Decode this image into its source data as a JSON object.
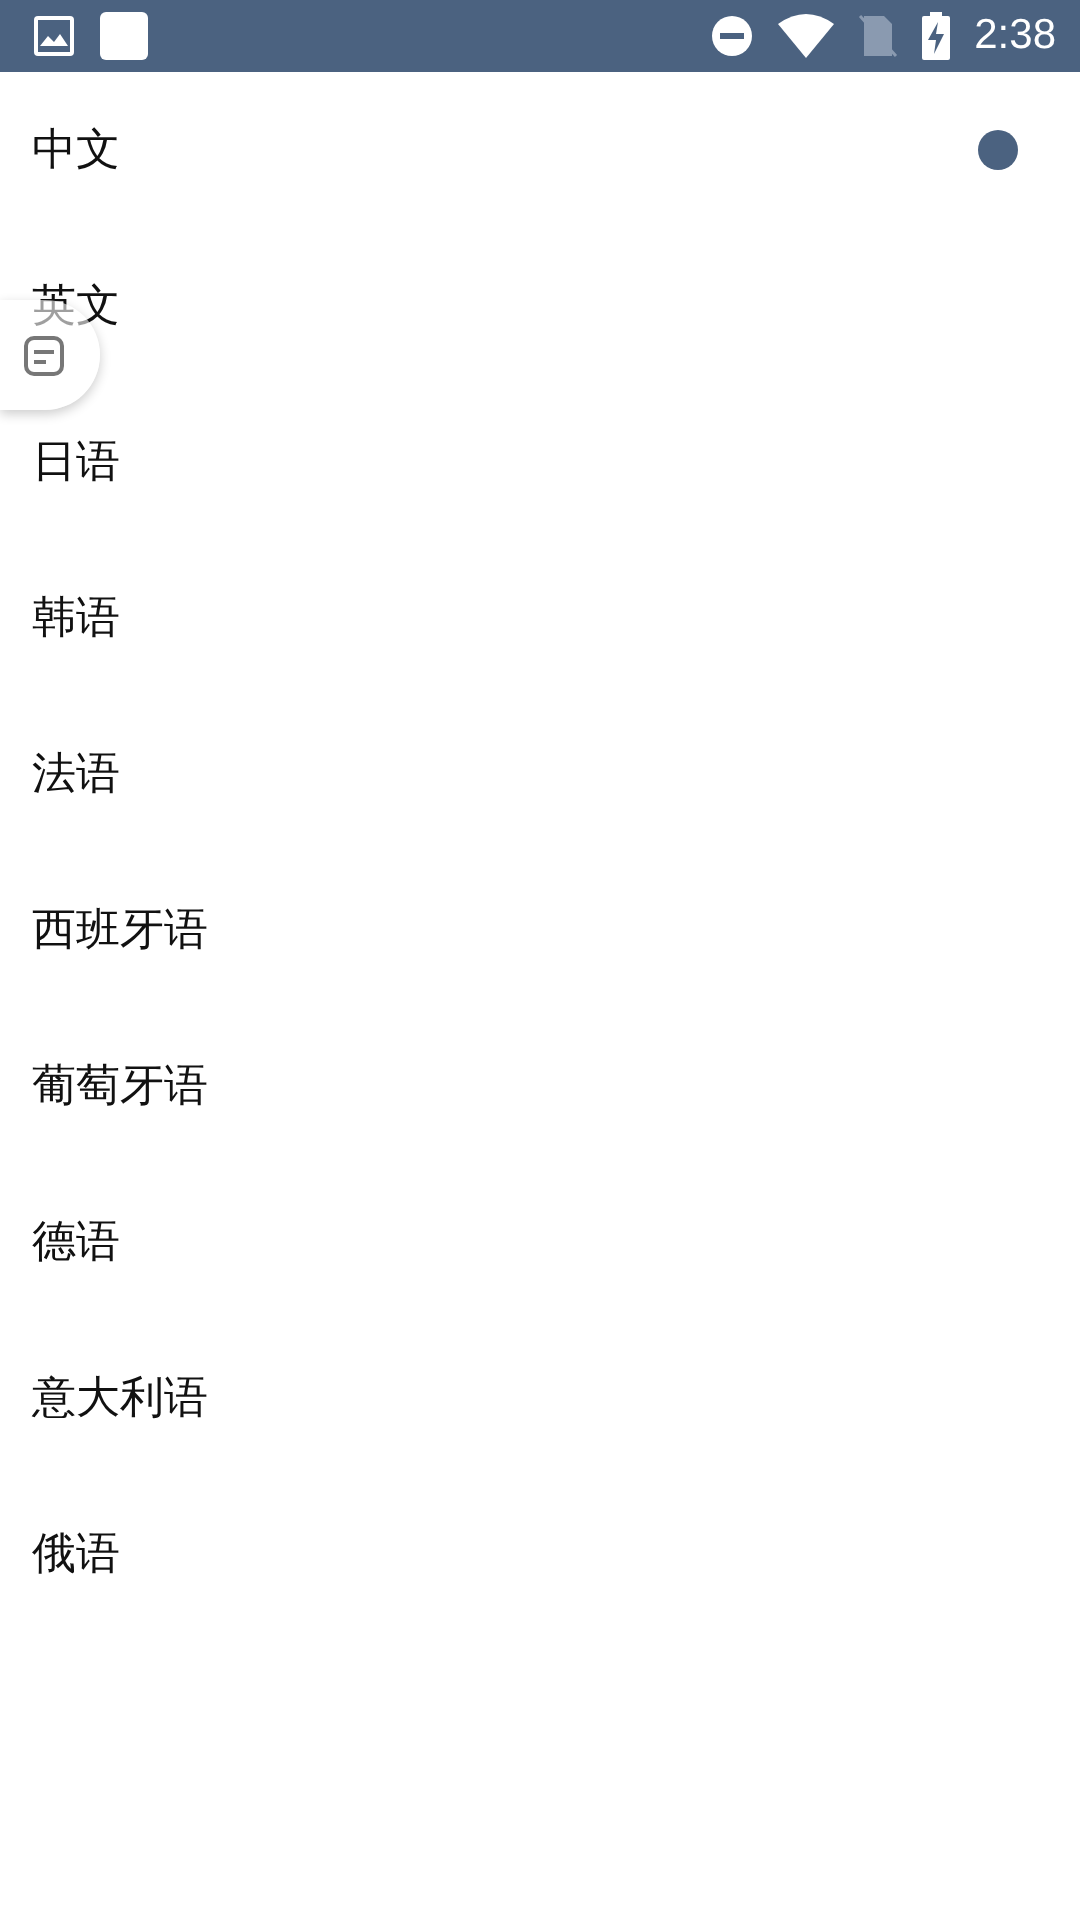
{
  "status_bar": {
    "time": "2:38"
  },
  "languages": [
    {
      "label": "中文",
      "selected": true
    },
    {
      "label": "英文",
      "selected": false
    },
    {
      "label": "日语",
      "selected": false
    },
    {
      "label": "韩语",
      "selected": false
    },
    {
      "label": "法语",
      "selected": false
    },
    {
      "label": "西班牙语",
      "selected": false
    },
    {
      "label": "葡萄牙语",
      "selected": false
    },
    {
      "label": "德语",
      "selected": false
    },
    {
      "label": "意大利语",
      "selected": false
    },
    {
      "label": "俄语",
      "selected": false
    }
  ]
}
